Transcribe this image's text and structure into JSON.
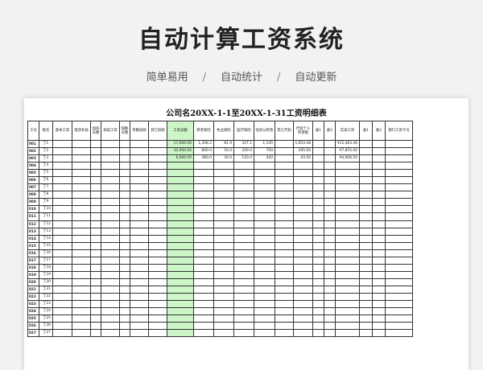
{
  "page": {
    "title": "自动计算工资系统",
    "subtitle_items": [
      "简单易用",
      "自动统计",
      "自动更新"
    ],
    "separator": "/"
  },
  "sheet": {
    "title": "公司名20XX-1-1至20XX-1-31工资明细表",
    "highlight_color": "#ccf5c8",
    "columns": [
      "工号",
      "姓名",
      "基本工资",
      "电话补贴",
      "加班天数",
      "加班工资",
      "缺勤天数",
      "考勤扣款",
      "其它扣款",
      "工资总额",
      "养老保险",
      "失业保险",
      "医疗保险",
      "住房公积金",
      "其它代扣",
      "代扣个人所得税",
      "备1",
      "备2",
      "实发工资",
      "备1",
      "备2",
      "银行工资卡号"
    ],
    "rows": [
      {
        "id": "001",
        "name": "丁1",
        "total": "17,000.00",
        "pension": "1,308.2",
        "unemployment": "81.9",
        "medical": "327.1",
        "housing": "1,145",
        "tax": "1,654.48",
        "net": "¥12,483.46"
      },
      {
        "id": "002",
        "name": "丁2",
        "total": "10,000.00",
        "pension": "800.0",
        "unemployment": "50.0",
        "medical": "200.0",
        "housing": "700",
        "tax": "395.00",
        "net": "¥7,855.00"
      },
      {
        "id": "003",
        "name": "丁3",
        "total": "6,000.00",
        "pension": "480.0",
        "unemployment": "30.0",
        "medical": "120.0",
        "housing": "420",
        "tax": "43.50",
        "net": "¥4,906.50"
      },
      {
        "id": "004",
        "name": "丁4"
      },
      {
        "id": "005",
        "name": "丁5"
      },
      {
        "id": "006",
        "name": "丁6"
      },
      {
        "id": "007",
        "name": "丁7"
      },
      {
        "id": "008",
        "name": "丁8"
      },
      {
        "id": "009",
        "name": "丁9"
      },
      {
        "id": "010",
        "name": "丁10"
      },
      {
        "id": "011",
        "name": "丁11"
      },
      {
        "id": "012",
        "name": "丁12"
      },
      {
        "id": "013",
        "name": "丁13"
      },
      {
        "id": "014",
        "name": "丁14"
      },
      {
        "id": "015",
        "name": "丁15"
      },
      {
        "id": "016",
        "name": "丁16"
      },
      {
        "id": "017",
        "name": "丁17"
      },
      {
        "id": "018",
        "name": "丁18"
      },
      {
        "id": "019",
        "name": "丁19"
      },
      {
        "id": "020",
        "name": "丁20"
      },
      {
        "id": "021",
        "name": "丁21"
      },
      {
        "id": "022",
        "name": "丁22"
      },
      {
        "id": "023",
        "name": "丁23"
      },
      {
        "id": "024",
        "name": "丁24"
      },
      {
        "id": "025",
        "name": "丁25"
      },
      {
        "id": "026",
        "name": "丁26"
      },
      {
        "id": "027",
        "name": "丁27"
      }
    ]
  }
}
